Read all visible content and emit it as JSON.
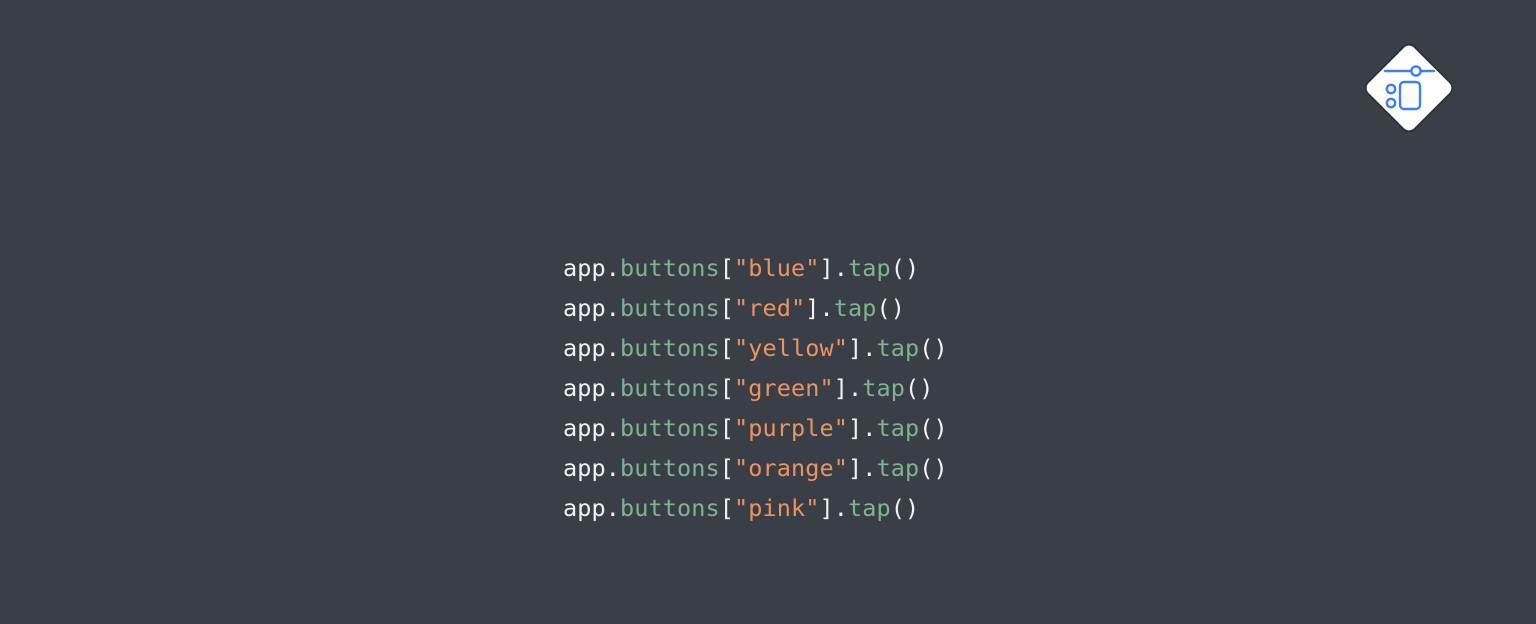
{
  "colors": {
    "background": "#3a3f47",
    "default_text": "#f2f2f2",
    "property": "#80b391",
    "string": "#ec9461",
    "logo_fill": "#ffffff",
    "logo_stroke": "#3f7ff2"
  },
  "logo": {
    "icon": "ui-components-diamond-icon"
  },
  "code": {
    "receiver": "app",
    "collection": "buttons",
    "method": "tap",
    "lines": [
      {
        "button": "\"blue\""
      },
      {
        "button": "\"red\""
      },
      {
        "button": "\"yellow\""
      },
      {
        "button": "\"green\""
      },
      {
        "button": "\"purple\""
      },
      {
        "button": "\"orange\""
      },
      {
        "button": "\"pink\""
      }
    ]
  }
}
